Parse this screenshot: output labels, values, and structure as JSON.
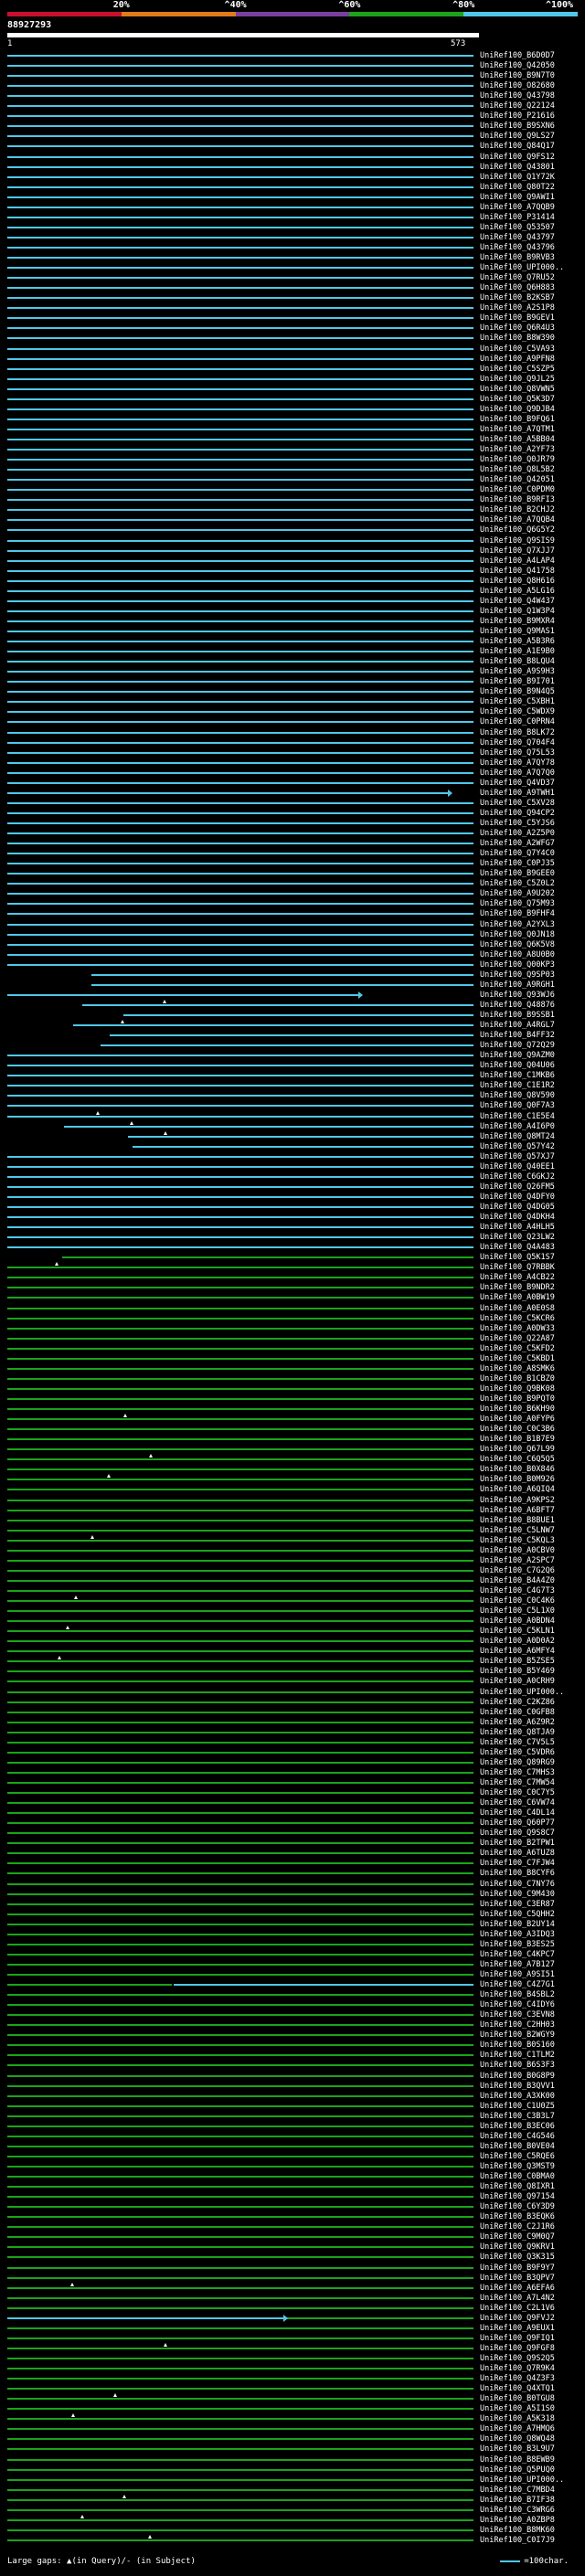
{
  "scale": {
    "labels": [
      "20%",
      "^40%",
      "^60%",
      "^80%",
      "^100%"
    ],
    "colors": [
      "#c8102e",
      "#e07b1a",
      "#7b3fa0",
      "#1ba31b",
      "#4fc8e8"
    ]
  },
  "query": {
    "id": "88927293",
    "start": "1",
    "end": "573"
  },
  "legend": {
    "gaps_text": "Large gaps: ▲(in Query)/- (in Subject)",
    "scale_text": "=100char."
  },
  "hit_colors": {
    "cyan": "#4fc8e8",
    "green": "#1ba31b"
  },
  "hits": [
    {
      "label": "UniRef100_B6D0D7",
      "color": "cyan"
    },
    {
      "label": "UniRef100_Q42050",
      "color": "cyan"
    },
    {
      "label": "UniRef100_B9N7T0",
      "color": "cyan"
    },
    {
      "label": "UniRef100_O82680",
      "color": "cyan"
    },
    {
      "label": "UniRef100_Q43798",
      "color": "cyan"
    },
    {
      "label": "UniRef100_Q22124",
      "color": "cyan"
    },
    {
      "label": "UniRef100_P21616",
      "color": "cyan"
    },
    {
      "label": "UniRef100_B9SXN6",
      "color": "cyan"
    },
    {
      "label": "UniRef100_Q9LS27",
      "color": "cyan"
    },
    {
      "label": "UniRef100_Q84Q17",
      "color": "cyan"
    },
    {
      "label": "UniRef100_Q9FS12",
      "color": "cyan"
    },
    {
      "label": "UniRef100_Q43801",
      "color": "cyan"
    },
    {
      "label": "UniRef100_Q1Y72K",
      "color": "cyan"
    },
    {
      "label": "UniRef100_Q80T22",
      "color": "cyan"
    },
    {
      "label": "UniRef100_Q9AWI1",
      "color": "cyan"
    },
    {
      "label": "UniRef100_A7QQB9",
      "color": "cyan"
    },
    {
      "label": "UniRef100_P31414",
      "color": "cyan"
    },
    {
      "label": "UniRef100_Q53507",
      "color": "cyan"
    },
    {
      "label": "UniRef100_Q43797",
      "color": "cyan"
    },
    {
      "label": "UniRef100_Q43796",
      "color": "cyan"
    },
    {
      "label": "UniRef100_B9RVB3",
      "color": "cyan"
    },
    {
      "label": "UniRef100_UPI000..",
      "color": "cyan"
    },
    {
      "label": "UniRef100_Q7RU52",
      "color": "cyan"
    },
    {
      "label": "UniRef100_Q6H883",
      "color": "cyan"
    },
    {
      "label": "UniRef100_B2KSB7",
      "color": "cyan"
    },
    {
      "label": "UniRef100_A2S1P8",
      "color": "cyan"
    },
    {
      "label": "UniRef100_B9GEV1",
      "color": "cyan"
    },
    {
      "label": "UniRef100_Q6R4U3",
      "color": "cyan"
    },
    {
      "label": "UniRef100_B8W390",
      "color": "cyan"
    },
    {
      "label": "UniRef100_C5VA93",
      "color": "cyan"
    },
    {
      "label": "UniRef100_A9PFN8",
      "color": "cyan"
    },
    {
      "label": "UniRef100_C5SZP5",
      "color": "cyan"
    },
    {
      "label": "UniRef100_Q9JL25",
      "color": "cyan"
    },
    {
      "label": "UniRef100_Q8VWN5",
      "color": "cyan"
    },
    {
      "label": "UniRef100_Q5K3D7",
      "color": "cyan"
    },
    {
      "label": "UniRef100_Q9DJB4",
      "color": "cyan"
    },
    {
      "label": "UniRef100_B9FQ61",
      "color": "cyan"
    },
    {
      "label": "UniRef100_A7QTM1",
      "color": "cyan"
    },
    {
      "label": "UniRef100_A5BB04",
      "color": "cyan"
    },
    {
      "label": "UniRef100_A2YF73",
      "color": "cyan"
    },
    {
      "label": "UniRef100_Q0JR79",
      "color": "cyan"
    },
    {
      "label": "UniRef100_Q8L5B2",
      "color": "cyan"
    },
    {
      "label": "UniRef100_Q42051",
      "color": "cyan"
    },
    {
      "label": "UniRef100_C0PDM0",
      "color": "cyan"
    },
    {
      "label": "UniRef100_B9RFI3",
      "color": "cyan"
    },
    {
      "label": "UniRef100_B2CHJ2",
      "color": "cyan"
    },
    {
      "label": "UniRef100_A7QQB4",
      "color": "cyan"
    },
    {
      "label": "UniRef100_Q6G5Y2",
      "color": "cyan"
    },
    {
      "label": "UniRef100_Q9SIS9",
      "color": "cyan"
    },
    {
      "label": "UniRef100_Q7XJJ7",
      "color": "cyan"
    },
    {
      "label": "UniRef100_A4LAP4",
      "color": "cyan"
    },
    {
      "label": "UniRef100_Q41758",
      "color": "cyan"
    },
    {
      "label": "UniRef100_Q8H616",
      "color": "cyan"
    },
    {
      "label": "UniRef100_A5LG16",
      "color": "cyan"
    },
    {
      "label": "UniRef100_Q4W437",
      "color": "cyan"
    },
    {
      "label": "UniRef100_Q1W3P4",
      "color": "cyan"
    },
    {
      "label": "UniRef100_B9MXR4",
      "color": "cyan"
    },
    {
      "label": "UniRef100_Q9MAS1",
      "color": "cyan"
    },
    {
      "label": "UniRef100_A5B3R6",
      "color": "cyan"
    },
    {
      "label": "UniRef100_A1E9B0",
      "color": "cyan"
    },
    {
      "label": "UniRef100_B8LQU4",
      "color": "cyan"
    },
    {
      "label": "UniRef100_A9S9H3",
      "color": "cyan"
    },
    {
      "label": "UniRef100_B9I701",
      "color": "cyan"
    },
    {
      "label": "UniRef100_B9N4Q5",
      "color": "cyan"
    },
    {
      "label": "UniRef100_C5XBH1",
      "color": "cyan"
    },
    {
      "label": "UniRef100_C5WDX9",
      "color": "cyan"
    },
    {
      "label": "UniRef100_C0PRN4",
      "color": "cyan"
    },
    {
      "label": "UniRef100_B8LK72",
      "color": "cyan"
    },
    {
      "label": "UniRef100_Q704F4",
      "color": "cyan"
    },
    {
      "label": "UniRef100_Q75L53",
      "color": "cyan"
    },
    {
      "label": "UniRef100_A7QY78",
      "color": "cyan"
    },
    {
      "label": "UniRef100_A7Q7Q0",
      "color": "cyan"
    },
    {
      "label": "UniRef100_Q4VD37",
      "color": "cyan"
    },
    {
      "label": "UniRef100_A9TWH1",
      "color": "cyan"
    },
    {
      "label": "UniRef100_C5XV28",
      "color": "cyan"
    },
    {
      "label": "UniRef100_Q94CP2",
      "color": "cyan"
    },
    {
      "label": "UniRef100_C5YJS6",
      "color": "cyan"
    },
    {
      "label": "UniRef100_A2Z5P0",
      "color": "cyan"
    },
    {
      "label": "UniRef100_A2WFG7",
      "color": "cyan"
    },
    {
      "label": "UniRef100_Q7Y4C0",
      "color": "cyan"
    },
    {
      "label": "UniRef100_C0PJ35",
      "color": "cyan"
    },
    {
      "label": "UniRef100_B9GEE0",
      "color": "cyan"
    },
    {
      "label": "UniRef100_C5Z0L2",
      "color": "cyan"
    },
    {
      "label": "UniRef100_A9U202",
      "color": "cyan"
    },
    {
      "label": "UniRef100_Q75M93",
      "color": "cyan"
    },
    {
      "label": "UniRef100_B9FHF4",
      "color": "cyan"
    },
    {
      "label": "UniRef100_A2YXL3",
      "color": "cyan"
    },
    {
      "label": "UniRef100_Q0JN18",
      "color": "cyan"
    },
    {
      "label": "UniRef100_Q6K5V8",
      "color": "cyan"
    },
    {
      "label": "UniRef100_A8U0B0",
      "color": "cyan"
    },
    {
      "label": "UniRef100_Q00KP3",
      "color": "cyan"
    },
    {
      "label": "UniRef100_Q9SP03",
      "color": "cyan"
    },
    {
      "label": "UniRef100_A9RGH1",
      "color": "cyan"
    },
    {
      "label": "UniRef100_Q93WJ6",
      "color": "cyan"
    },
    {
      "label": "UniRef100_Q48876",
      "color": "cyan"
    },
    {
      "label": "UniRef100_B9SSB1",
      "color": "cyan"
    },
    {
      "label": "UniRef100_A4RGL7",
      "color": "cyan"
    },
    {
      "label": "UniRef100_B4FF32",
      "color": "cyan"
    },
    {
      "label": "UniRef100_Q72Q29",
      "color": "cyan"
    },
    {
      "label": "UniRef100_Q9AZM0",
      "color": "cyan"
    },
    {
      "label": "UniRef100_Q04U06",
      "color": "cyan"
    },
    {
      "label": "UniRef100_C1MKB6",
      "color": "cyan"
    },
    {
      "label": "UniRef100_C1E1R2",
      "color": "cyan"
    },
    {
      "label": "UniRef100_Q8V590",
      "color": "cyan"
    },
    {
      "label": "UniRef100_Q0F7A3",
      "color": "cyan"
    },
    {
      "label": "UniRef100_C1E5E4",
      "color": "cyan"
    },
    {
      "label": "UniRef100_A4I6P0",
      "color": "cyan"
    },
    {
      "label": "UniRef100_Q8MT24",
      "color": "cyan"
    },
    {
      "label": "UniRef100_Q57Y42",
      "color": "cyan"
    },
    {
      "label": "UniRef100_Q57XJ7",
      "color": "cyan"
    },
    {
      "label": "UniRef100_Q40EE1",
      "color": "cyan"
    },
    {
      "label": "UniRef100_C6GKJ2",
      "color": "cyan"
    },
    {
      "label": "UniRef100_Q26FM5",
      "color": "cyan"
    },
    {
      "label": "UniRef100_Q4DFY0",
      "color": "cyan"
    },
    {
      "label": "UniRef100_Q4DG05",
      "color": "cyan"
    },
    {
      "label": "UniRef100_Q4DKH4",
      "color": "cyan"
    },
    {
      "label": "UniRef100_A4HLH5",
      "color": "cyan"
    },
    {
      "label": "UniRef100_Q23LW2",
      "color": "cyan"
    },
    {
      "label": "UniRef100_Q4A483",
      "color": "cyan"
    },
    {
      "label": "UniRef100_Q5K1S7",
      "color": "green"
    },
    {
      "label": "UniRef100_Q7RBBK",
      "color": "green"
    },
    {
      "label": "UniRef100_A4CB22",
      "color": "green"
    },
    {
      "label": "UniRef100_B9NDR2",
      "color": "green"
    },
    {
      "label": "UniRef100_A0BW19",
      "color": "green"
    },
    {
      "label": "UniRef100_A0E0S8",
      "color": "green"
    },
    {
      "label": "UniRef100_C5KCR6",
      "color": "green"
    },
    {
      "label": "UniRef100_A0DW33",
      "color": "green"
    },
    {
      "label": "UniRef100_Q22A87",
      "color": "green"
    },
    {
      "label": "UniRef100_C5KFD2",
      "color": "green"
    },
    {
      "label": "UniRef100_C5KBD1",
      "color": "green"
    },
    {
      "label": "UniRef100_A8SMK6",
      "color": "green"
    },
    {
      "label": "UniRef100_B1CBZ0",
      "color": "green"
    },
    {
      "label": "UniRef100_Q9BK08",
      "color": "green"
    },
    {
      "label": "UniRef100_B9PQT0",
      "color": "green"
    },
    {
      "label": "UniRef100_B6KH90",
      "color": "green"
    },
    {
      "label": "UniRef100_A0FYP6",
      "color": "green"
    },
    {
      "label": "UniRef100_C0C3B6",
      "color": "green"
    },
    {
      "label": "UniRef100_B1B7E9",
      "color": "green"
    },
    {
      "label": "UniRef100_Q67L99",
      "color": "green"
    },
    {
      "label": "UniRef100_C6Q5Q5",
      "color": "green"
    },
    {
      "label": "UniRef100_B0X846",
      "color": "green"
    },
    {
      "label": "UniRef100_B0M926",
      "color": "green"
    },
    {
      "label": "UniRef100_A6QIQ4",
      "color": "green"
    },
    {
      "label": "UniRef100_A9KPS2",
      "color": "green"
    },
    {
      "label": "UniRef100_A6BFT7",
      "color": "green"
    },
    {
      "label": "UniRef100_B8BUE1",
      "color": "green"
    },
    {
      "label": "UniRef100_C5LNW7",
      "color": "green"
    },
    {
      "label": "UniRef100_C5KQL3",
      "color": "green"
    },
    {
      "label": "UniRef100_A0CBV0",
      "color": "green"
    },
    {
      "label": "UniRef100_A2SPC7",
      "color": "green"
    },
    {
      "label": "UniRef100_C7G2Q6",
      "color": "green"
    },
    {
      "label": "UniRef100_B4A4Z0",
      "color": "green"
    },
    {
      "label": "UniRef100_C4G7T3",
      "color": "green"
    },
    {
      "label": "UniRef100_C0C4K6",
      "color": "green"
    },
    {
      "label": "UniRef100_C5L1X0",
      "color": "green"
    },
    {
      "label": "UniRef100_A0BDN4",
      "color": "green"
    },
    {
      "label": "UniRef100_C5KLN1",
      "color": "green"
    },
    {
      "label": "UniRef100_A0D0A2",
      "color": "green"
    },
    {
      "label": "UniRef100_A6MFY4",
      "color": "green"
    },
    {
      "label": "UniRef100_B5ZSE5",
      "color": "green"
    },
    {
      "label": "UniRef100_B5Y469",
      "color": "green"
    },
    {
      "label": "UniRef100_A0CRH9",
      "color": "green"
    },
    {
      "label": "UniRef100_UPI000..",
      "color": "green"
    },
    {
      "label": "UniRef100_C2KZ86",
      "color": "green"
    },
    {
      "label": "UniRef100_C0GFB8",
      "color": "green"
    },
    {
      "label": "UniRef100_A6Z9R2",
      "color": "green"
    },
    {
      "label": "UniRef100_Q8TJA9",
      "color": "green"
    },
    {
      "label": "UniRef100_C7V5L5",
      "color": "green"
    },
    {
      "label": "UniRef100_C5VDR6",
      "color": "green"
    },
    {
      "label": "UniRef100_Q89RG9",
      "color": "green"
    },
    {
      "label": "UniRef100_C7MHS3",
      "color": "green"
    },
    {
      "label": "UniRef100_C7MW54",
      "color": "green"
    },
    {
      "label": "UniRef100_C0C7Y5",
      "color": "green"
    },
    {
      "label": "UniRef100_C6VW74",
      "color": "green"
    },
    {
      "label": "UniRef100_C4DL14",
      "color": "green"
    },
    {
      "label": "UniRef100_Q60P77",
      "color": "green"
    },
    {
      "label": "UniRef100_Q9S8C7",
      "color": "green"
    },
    {
      "label": "UniRef100_B2TPW1",
      "color": "green"
    },
    {
      "label": "UniRef100_A6TUZ8",
      "color": "green"
    },
    {
      "label": "UniRef100_C7FJW4",
      "color": "green"
    },
    {
      "label": "UniRef100_B8CYF6",
      "color": "green"
    },
    {
      "label": "UniRef100_C7NY76",
      "color": "green"
    },
    {
      "label": "UniRef100_C9M430",
      "color": "green"
    },
    {
      "label": "UniRef100_C3ER87",
      "color": "green"
    },
    {
      "label": "UniRef100_C5QHH2",
      "color": "green"
    },
    {
      "label": "UniRef100_B2UY14",
      "color": "green"
    },
    {
      "label": "UniRef100_A3IDQ3",
      "color": "green"
    },
    {
      "label": "UniRef100_B3ES25",
      "color": "green"
    },
    {
      "label": "UniRef100_C4KPC7",
      "color": "green"
    },
    {
      "label": "UniRef100_A7B127",
      "color": "green"
    },
    {
      "label": "UniRef100_A9SI51",
      "color": "green"
    },
    {
      "label": "UniRef100_C4Z7G1",
      "color": "green"
    },
    {
      "label": "UniRef100_B4SBL2",
      "color": "green"
    },
    {
      "label": "UniRef100_C4IDY6",
      "color": "green"
    },
    {
      "label": "UniRef100_C3EVN8",
      "color": "green"
    },
    {
      "label": "UniRef100_C2HH03",
      "color": "green"
    },
    {
      "label": "UniRef100_B2WGY9",
      "color": "green"
    },
    {
      "label": "UniRef100_B0S160",
      "color": "green"
    },
    {
      "label": "UniRef100_C1TLM2",
      "color": "green"
    },
    {
      "label": "UniRef100_B6S3F3",
      "color": "green"
    },
    {
      "label": "UniRef100_B0G8P9",
      "color": "green"
    },
    {
      "label": "UniRef100_B3QVV1",
      "color": "green"
    },
    {
      "label": "UniRef100_A3XK00",
      "color": "green"
    },
    {
      "label": "UniRef100_C1U0Z5",
      "color": "green"
    },
    {
      "label": "UniRef100_C3B3L7",
      "color": "green"
    },
    {
      "label": "UniRef100_B3EC06",
      "color": "green"
    },
    {
      "label": "UniRef100_C4G546",
      "color": "green"
    },
    {
      "label": "UniRef100_B0VE04",
      "color": "green"
    },
    {
      "label": "UniRef100_C5RQE6",
      "color": "green"
    },
    {
      "label": "UniRef100_Q3MST9",
      "color": "green"
    },
    {
      "label": "UniRef100_C0BMA0",
      "color": "green"
    },
    {
      "label": "UniRef100_Q8IXR1",
      "color": "green"
    },
    {
      "label": "UniRef100_Q97154",
      "color": "green"
    },
    {
      "label": "UniRef100_C6Y3D9",
      "color": "green"
    },
    {
      "label": "UniRef100_B3EQK6",
      "color": "green"
    },
    {
      "label": "UniRef100_C2J1R6",
      "color": "green"
    },
    {
      "label": "UniRef100_C9M0Q7",
      "color": "green"
    },
    {
      "label": "UniRef100_Q9KRV1",
      "color": "green"
    },
    {
      "label": "UniRef100_Q3K315",
      "color": "green"
    },
    {
      "label": "UniRef100_B9F9Y7",
      "color": "green"
    },
    {
      "label": "UniRef100_B3QPV7",
      "color": "green"
    },
    {
      "label": "UniRef100_A6EFA6",
      "color": "green"
    },
    {
      "label": "UniRef100_A7L4N2",
      "color": "green"
    },
    {
      "label": "UniRef100_C2L1V6",
      "color": "green"
    },
    {
      "label": "UniRef100_Q9FVJ2",
      "color": "green"
    },
    {
      "label": "UniRef100_A9EUX1",
      "color": "green"
    },
    {
      "label": "UniRef100_Q9FIQ1",
      "color": "green"
    },
    {
      "label": "UniRef100_Q9FGF8",
      "color": "green"
    },
    {
      "label": "UniRef100_Q9S2Q5",
      "color": "green"
    },
    {
      "label": "UniRef100_Q7R9K4",
      "color": "green"
    },
    {
      "label": "UniRef100_Q4Z3F3",
      "color": "green"
    },
    {
      "label": "UniRef100_Q4XTQ1",
      "color": "green"
    },
    {
      "label": "UniRef100_B0TGU8",
      "color": "green"
    },
    {
      "label": "UniRef100_A5I1S0",
      "color": "green"
    },
    {
      "label": "UniRef100_A5K318",
      "color": "green"
    },
    {
      "label": "UniRef100_A7HMQ6",
      "color": "green"
    },
    {
      "label": "UniRef100_Q8WQ48",
      "color": "green"
    },
    {
      "label": "UniRef100_B3L9U7",
      "color": "green"
    },
    {
      "label": "UniRef100_B8EWB9",
      "color": "green"
    },
    {
      "label": "UniRef100_Q5PUQ0",
      "color": "green"
    },
    {
      "label": "UniRef100_UPI000..",
      "color": "green"
    },
    {
      "label": "UniRef100_C7MBD4",
      "color": "green"
    },
    {
      "label": "UniRef100_B7IF38",
      "color": "green"
    },
    {
      "label": "UniRef100_C3WRG6",
      "color": "green"
    },
    {
      "label": "UniRef100_A0ZBP8",
      "color": "green"
    },
    {
      "label": "UniRef100_B8MK60",
      "color": "green"
    },
    {
      "label": "UniRef100_C0I7J9",
      "color": "green"
    }
  ]
}
